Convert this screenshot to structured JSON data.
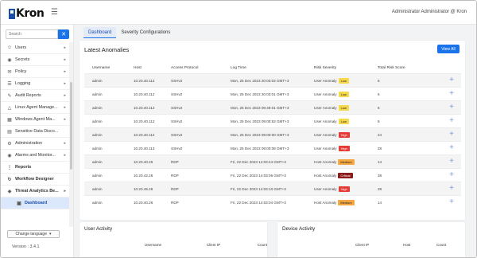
{
  "app": {
    "logo_text": "Kron",
    "user_menu": "Administrator Administrator @ Kron"
  },
  "sidebar": {
    "search_placeholder": "Search",
    "items": [
      {
        "label": "Users",
        "icon": "users-icon",
        "caret": true
      },
      {
        "label": "Secrets",
        "icon": "lock-icon",
        "caret": true
      },
      {
        "label": "Policy",
        "icon": "policy-icon",
        "caret": true
      },
      {
        "label": "Logging",
        "icon": "logging-icon",
        "caret": true
      },
      {
        "label": "Audit Reports",
        "icon": "audit-icon",
        "caret": true
      },
      {
        "label": "Linux Agent Manage...",
        "icon": "linux-icon",
        "caret": true
      },
      {
        "label": "Windows Agent Ma...",
        "icon": "windows-icon",
        "caret": true
      },
      {
        "label": "Sensitive Data Disco...",
        "icon": "data-icon",
        "caret": false
      },
      {
        "label": "Administration",
        "icon": "gear-icon",
        "caret": true
      },
      {
        "label": "Alarms and Monitor...",
        "icon": "bell-icon",
        "caret": true
      },
      {
        "label": "Reports",
        "icon": "reports-icon",
        "caret": false
      },
      {
        "label": "Workflow Designer",
        "icon": "workflow-icon",
        "caret": false
      },
      {
        "label": "Threat Analytics Be...",
        "icon": "shield-icon",
        "caret": true
      }
    ],
    "active_item": "Dashboard",
    "change_language": "Change language",
    "version": "Version : 3.4.1"
  },
  "tabs": [
    {
      "label": "Dashboard",
      "active": true
    },
    {
      "label": "Severity Configurations",
      "active": false
    }
  ],
  "anomalies": {
    "title": "Latest Anomalies",
    "view_all": "View All",
    "columns": [
      "Username",
      "Host",
      "Access Protocol",
      "Log Time",
      "Risk Severity",
      "Total Risk Score"
    ],
    "rows": [
      {
        "user": "admin",
        "host": "10.20.40.112",
        "protocol": "SSHv2",
        "time": "Mon, 25 Dec 2023 20:03:03 GMT+3",
        "anomaly": "User Anomaly",
        "severity": "Low",
        "sev_color": "#f5d94a",
        "score": "6"
      },
      {
        "user": "admin",
        "host": "10.20.40.112",
        "protocol": "SSHv2",
        "time": "Mon, 25 Dec 2023 20:03:01 GMT+3",
        "anomaly": "User Anomaly",
        "severity": "Low",
        "sev_color": "#f5d94a",
        "score": "6"
      },
      {
        "user": "admin",
        "host": "10.20.40.112",
        "protocol": "SSHv2",
        "time": "Mon, 25 Dec 2023 09:49:01 GMT+3",
        "anomaly": "User Anomaly",
        "severity": "Low",
        "sev_color": "#f5d94a",
        "score": "6"
      },
      {
        "user": "admin",
        "host": "10.20.40.112",
        "protocol": "SSHv2",
        "time": "Mon, 25 Dec 2023 09:00:53 GMT+3",
        "anomaly": "User Anomaly",
        "severity": "Low",
        "sev_color": "#f5d94a",
        "score": "6"
      },
      {
        "user": "admin",
        "host": "10.20.40.112",
        "protocol": "SSHv2",
        "time": "Mon, 25 Dec 2023 09:00:00 GMT+3",
        "anomaly": "User Anomaly",
        "severity": "High",
        "sev_color": "#e53935",
        "score": "24"
      },
      {
        "user": "admin",
        "host": "10.20.40.113",
        "protocol": "SSHv2",
        "time": "Mon, 25 Dec 2023 09:00:08 GMT+3",
        "anomaly": "User Anomaly",
        "severity": "High",
        "sev_color": "#e53935",
        "score": "28"
      },
      {
        "user": "admin",
        "host": "10.20.40.26",
        "protocol": "RDP",
        "time": "Fri, 22 Dec 2023 14:03:44 GMT+3",
        "anomaly": "Host Anomaly",
        "severity": "Medium",
        "sev_color": "#f5a742",
        "score": "14"
      },
      {
        "user": "admin",
        "host": "10.20.42.26",
        "protocol": "RDP",
        "time": "Fri, 22 Dec 2023 14:03:06 GMT+3",
        "anomaly": "Host Anomaly",
        "severity": "Critical",
        "sev_color": "#8e1b1b",
        "score": "38"
      },
      {
        "user": "admin",
        "host": "10.20.45.26",
        "protocol": "RDP",
        "time": "Fri, 22 Dec 2023 14:03:10 GMT+3",
        "anomaly": "User Anomaly",
        "severity": "High",
        "sev_color": "#e53935",
        "score": "28"
      },
      {
        "user": "admin",
        "host": "10.20.40.26",
        "protocol": "RDP",
        "time": "Fri, 22 Dec 2023 14:03:04 GMT+3",
        "anomaly": "Host Anomaly",
        "severity": "Medium",
        "sev_color": "#f5a742",
        "score": "14"
      }
    ]
  },
  "user_activity": {
    "title": "User Activity",
    "columns": [
      "Username",
      "Client IP",
      "Count"
    ]
  },
  "device_activity": {
    "title": "Device Activity",
    "columns": [
      "Client IP",
      "Host",
      "Count"
    ]
  }
}
